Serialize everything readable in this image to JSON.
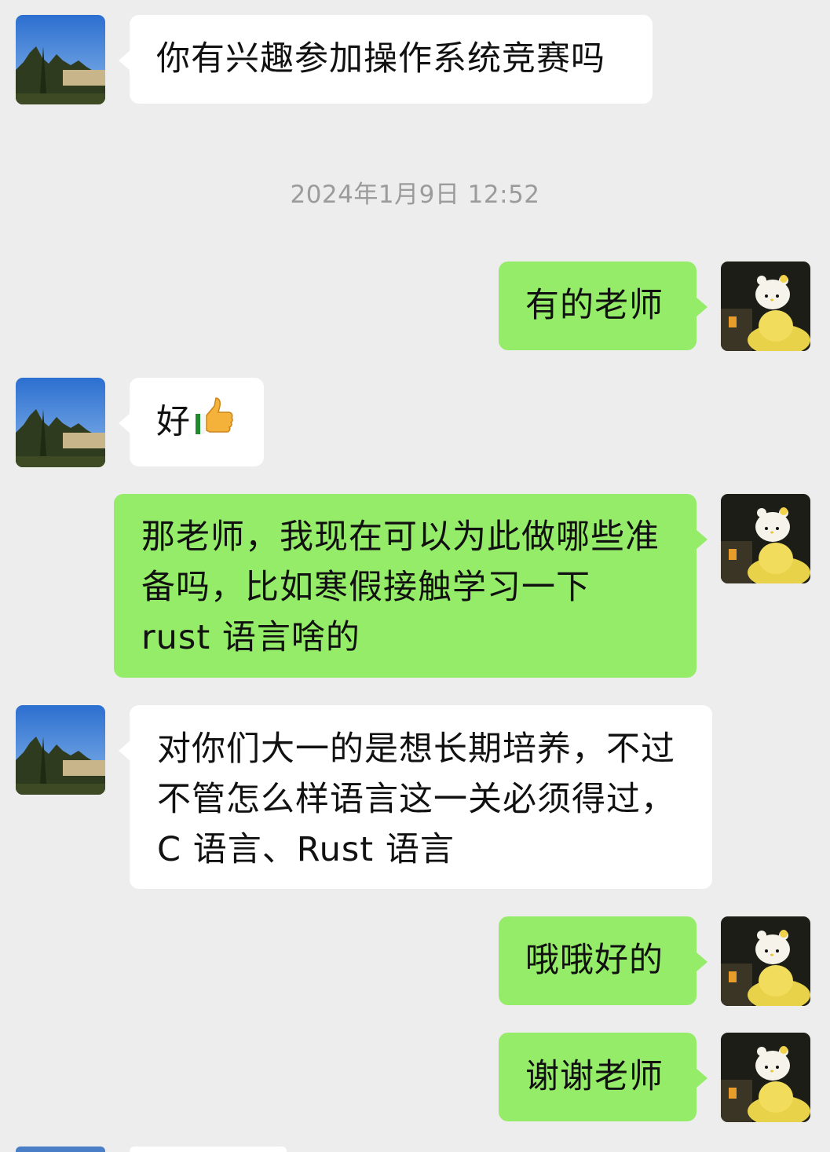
{
  "conversation": {
    "timestamp": "2024年1月9日 12:52",
    "messages": [
      {
        "side": "left",
        "text": "你有兴趣参加操作系统竞赛吗"
      },
      {
        "side": "right",
        "text": "有的老师"
      },
      {
        "side": "left",
        "text": "好",
        "emoji": "thumbs-up-icon"
      },
      {
        "side": "right",
        "text": "那老师，我现在可以为此做哪些准备吗，比如寒假接触学习一下 rust 语言啥的"
      },
      {
        "side": "left",
        "text": "对你们大一的是想长期培养，不过不管怎么样语言这一关必须得过，C 语言、Rust 语言"
      },
      {
        "side": "right",
        "text": "哦哦好的"
      },
      {
        "side": "right",
        "text": "谢谢老师"
      }
    ]
  },
  "colors": {
    "background": "#ededed",
    "incoming_bubble": "#ffffff",
    "outgoing_bubble": "#95ec69",
    "timestamp_text": "#9b9b9b"
  }
}
